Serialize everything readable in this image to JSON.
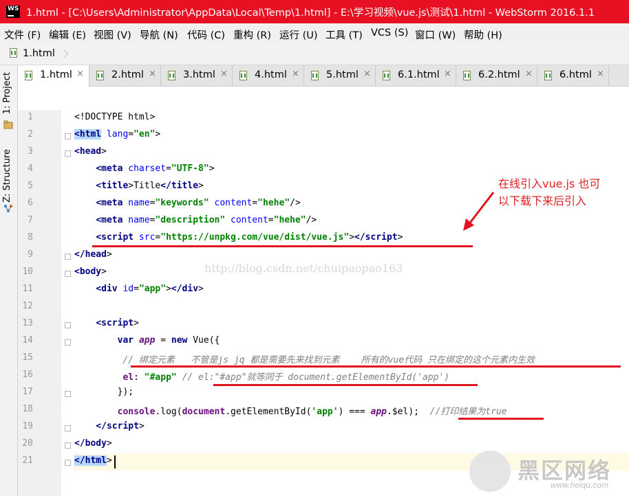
{
  "window": {
    "app_icon": "WS",
    "title": "1.html - [C:\\Users\\Administrator\\AppData\\Local\\Temp\\1.html] - E:\\学习视频\\vue.js\\测试\\1.html - WebStorm 2016.1.1"
  },
  "menu": [
    "文件 (F)",
    "编辑 (E)",
    "视图 (V)",
    "导航 (N)",
    "代码 (C)",
    "重构 (R)",
    "运行 (U)",
    "工具 (T)",
    "VCS (S)",
    "窗口 (W)",
    "帮助 (H)"
  ],
  "navbar": {
    "crumb": "1.html"
  },
  "toolstrip": {
    "project": "1: Project",
    "structure": "Z: Structure"
  },
  "tabs": [
    {
      "label": "1.html",
      "active": true
    },
    {
      "label": "2.html"
    },
    {
      "label": "3.html"
    },
    {
      "label": "4.html"
    },
    {
      "label": "5.html"
    },
    {
      "label": "6.1.html"
    },
    {
      "label": "6.2.html"
    },
    {
      "label": "6.html"
    }
  ],
  "close_glyph": "×",
  "editor": {
    "line_numbers": [
      "1",
      "2",
      "3",
      "4",
      "5",
      "6",
      "7",
      "8",
      "9",
      "10",
      "11",
      "12",
      "13",
      "14",
      "15",
      "16",
      "17",
      "18",
      "19",
      "20",
      "21"
    ],
    "lines": [
      [
        [
          "",
          "<!DOCTYPE html>"
        ]
      ],
      [
        [
          "hl-tag",
          "<html"
        ],
        [
          "attr",
          " lang"
        ],
        [
          "",
          "="
        ],
        [
          "str",
          "\"en\""
        ],
        [
          "",
          ">"
        ]
      ],
      [
        [
          "tag",
          "<head"
        ],
        [
          "",
          ">"
        ]
      ],
      [
        [
          "",
          "    "
        ],
        [
          "tag",
          "<meta"
        ],
        [
          "attr",
          " charset"
        ],
        [
          "",
          "="
        ],
        [
          "str",
          "\"UTF-8\""
        ],
        [
          "",
          ">"
        ]
      ],
      [
        [
          "",
          "    "
        ],
        [
          "tag",
          "<title"
        ],
        [
          "",
          ">Title"
        ],
        [
          "tag",
          "</title"
        ],
        [
          "",
          ">"
        ]
      ],
      [
        [
          "",
          "    "
        ],
        [
          "tag",
          "<meta"
        ],
        [
          "attr",
          " name"
        ],
        [
          "",
          "="
        ],
        [
          "str",
          "\"keywords\""
        ],
        [
          "attr",
          " content"
        ],
        [
          "",
          "="
        ],
        [
          "str",
          "\"hehe\""
        ],
        [
          "",
          "/>"
        ]
      ],
      [
        [
          "",
          "    "
        ],
        [
          "tag",
          "<meta"
        ],
        [
          "attr",
          " name"
        ],
        [
          "",
          "="
        ],
        [
          "str",
          "\"description\""
        ],
        [
          "attr",
          " content"
        ],
        [
          "",
          "="
        ],
        [
          "str",
          "\"hehe\""
        ],
        [
          "",
          "/>"
        ]
      ],
      [
        [
          "",
          "    "
        ],
        [
          "tag",
          "<script"
        ],
        [
          "attr",
          " src"
        ],
        [
          "",
          "="
        ],
        [
          "str",
          "\"https://unpkg.com/vue/dist/vue.js\""
        ],
        [
          "",
          ">"
        ],
        [
          "tag",
          "</script"
        ],
        [
          "",
          ">"
        ]
      ],
      [
        [
          "tag",
          "</head"
        ],
        [
          "",
          ">"
        ]
      ],
      [
        [
          "tag",
          "<body"
        ],
        [
          "",
          ">"
        ]
      ],
      [
        [
          "",
          "    "
        ],
        [
          "tag",
          "<div"
        ],
        [
          "attr",
          " id"
        ],
        [
          "",
          "="
        ],
        [
          "str",
          "\"app\""
        ],
        [
          "",
          ">"
        ],
        [
          "tag",
          "</div"
        ],
        [
          "",
          ">"
        ]
      ],
      [
        [
          "",
          ""
        ]
      ],
      [
        [
          "",
          "    "
        ],
        [
          "tag",
          "<script"
        ],
        [
          "",
          ">"
        ]
      ],
      [
        [
          "",
          "        "
        ],
        [
          "kw",
          "var "
        ],
        [
          "var",
          "app"
        ],
        [
          "",
          " = "
        ],
        [
          "kw",
          "new "
        ],
        [
          "",
          "Vue({"
        ]
      ],
      [
        [
          "",
          "         "
        ],
        [
          "cmt",
          "// 绑定元素   不管是js jq 都是需要先来找到元素    所有的vue代码 只在绑定的这个元素内生效"
        ]
      ],
      [
        [
          "",
          "         "
        ],
        [
          "prop",
          "el"
        ],
        [
          "",
          ": "
        ],
        [
          "str",
          "\"#app\""
        ],
        [
          "",
          " "
        ],
        [
          "cmt",
          "// el:\"#app\"就等同于 document.getElementById('app')"
        ]
      ],
      [
        [
          "",
          "        });"
        ]
      ],
      [
        [
          "",
          "        "
        ],
        [
          "prop",
          "console"
        ],
        [
          "",
          ".log("
        ],
        [
          "prop",
          "document"
        ],
        [
          "",
          ".getElementById("
        ],
        [
          "str",
          "'app'"
        ],
        [
          "",
          ") === "
        ],
        [
          "var",
          "app"
        ],
        [
          "",
          ".$el);  "
        ],
        [
          "cmt",
          "//打印结果为true"
        ]
      ],
      [
        [
          "",
          "    "
        ],
        [
          "tag",
          "</script"
        ],
        [
          "",
          ">"
        ]
      ],
      [
        [
          "tag",
          "</body"
        ],
        [
          "",
          ">"
        ]
      ],
      [
        [
          "hl-tag",
          "</html"
        ],
        [
          "",
          ">"
        ]
      ]
    ]
  },
  "annotation": {
    "line1": "在线引入vue.js  也可",
    "line2": "以下载下来后引入"
  },
  "watermark": "http://blog.csdn.net/chuipaopao163",
  "logo": {
    "text": "黑区网络",
    "url": "www.heiqu.com"
  }
}
